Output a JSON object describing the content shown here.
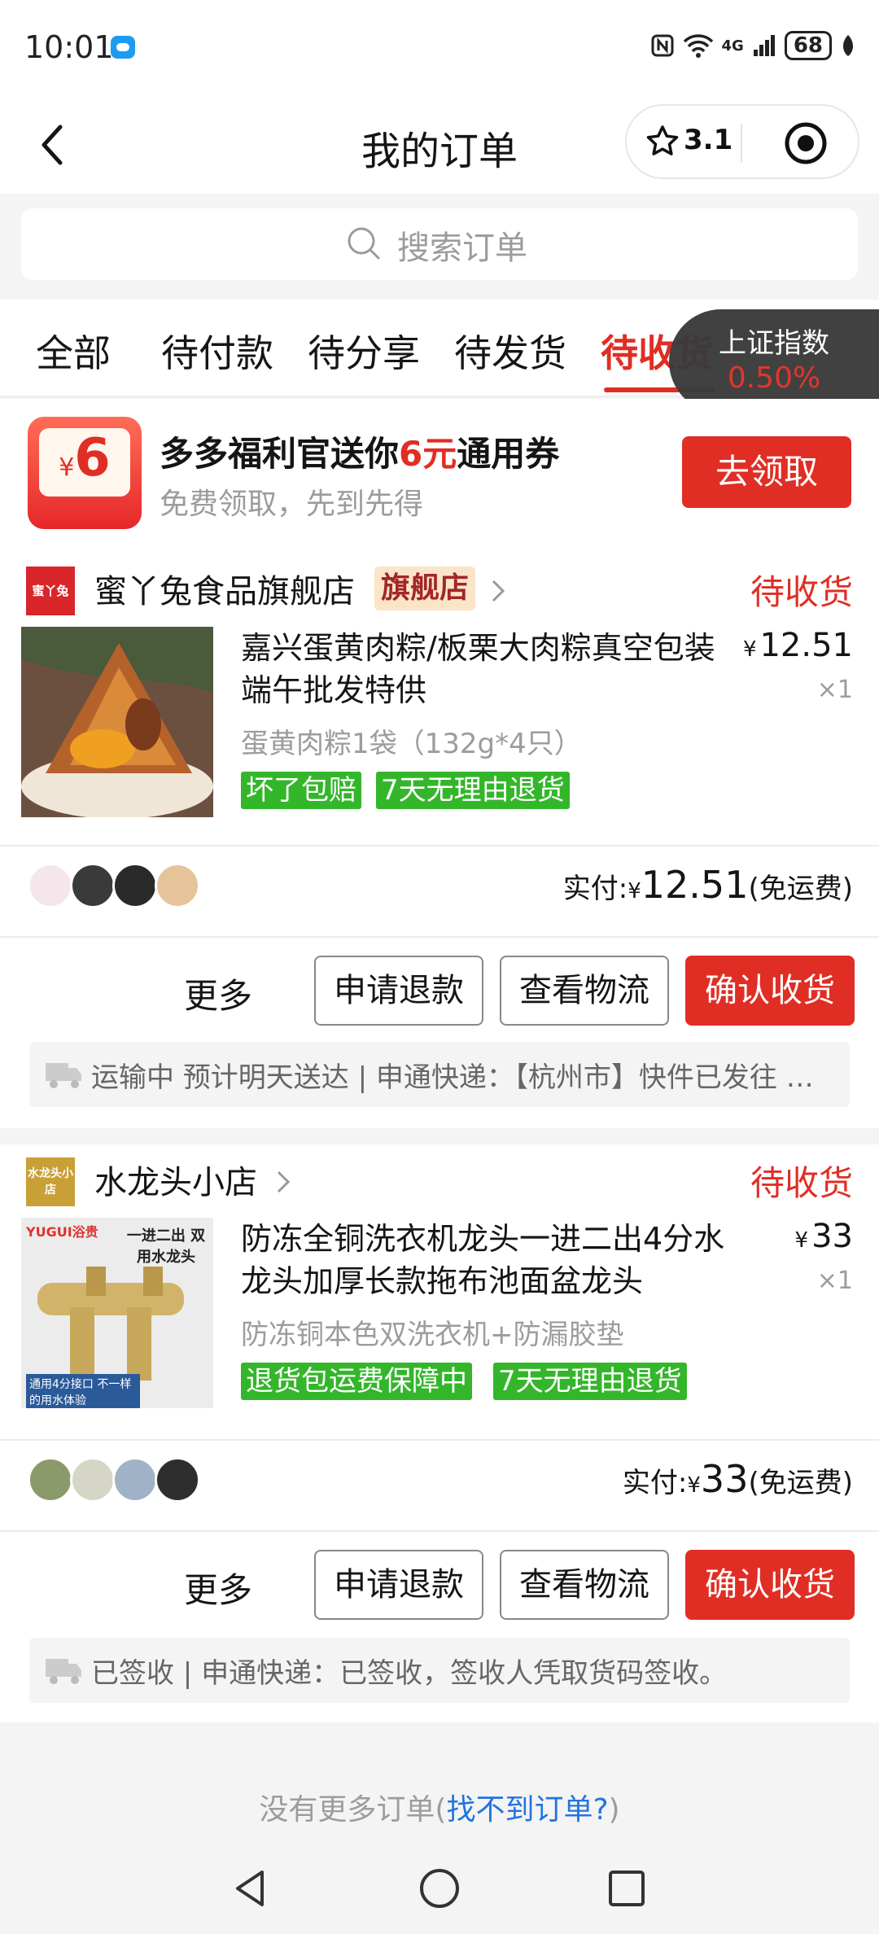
{
  "status_bar": {
    "time": "10:01",
    "network": "4G",
    "battery": "68"
  },
  "header": {
    "title": "我的订单",
    "back_icon": "chevron-left-icon",
    "rating": "3.1"
  },
  "search": {
    "placeholder": "搜索订单"
  },
  "tabs": [
    {
      "label": "全部"
    },
    {
      "label": "待付款"
    },
    {
      "label": "待分享"
    },
    {
      "label": "待发货"
    },
    {
      "label": "待收货",
      "active": true
    }
  ],
  "stock_widget": {
    "name": "上证指数",
    "value": "0.50%"
  },
  "coupon_banner": {
    "icon_currency": "¥",
    "icon_amount": "6",
    "title_prefix": "多多福利官送你",
    "title_highlight": "6元",
    "title_suffix": "通用券",
    "subtitle": "免费领取，先到先得",
    "button": "去领取"
  },
  "orders": [
    {
      "shop_logo_text": "蜜丫兔",
      "shop_name": "蜜丫兔食品旗舰店",
      "shop_badge": "旗舰店",
      "status": "待收货",
      "title": "嘉兴蛋黄肉粽/板栗大肉粽真空包装端午批发特供",
      "spec": "蛋黄肉粽1袋（132g*4只）",
      "currency": "¥",
      "price": "12.51",
      "qty": "×1",
      "tags": [
        "坏了包赔",
        "7天无理由退货"
      ],
      "paid_label": "实付:",
      "paid_amount": "12.51",
      "shipping_note": "(免运费)",
      "more": "更多",
      "buttons": [
        "申请退款",
        "查看物流",
        "确认收货"
      ],
      "logistics": "运输中 预计明天送达 | 申通快递：【杭州市】快件已发往 金华中转部"
    },
    {
      "shop_logo_text": "水龙头小店",
      "shop_name": "水龙头小店",
      "status": "待收货",
      "title": "防冻全铜洗衣机龙头一进二出4分水龙头加厚长款拖布池面盆龙头",
      "spec": "防冻铜本色双洗衣机+防漏胶垫",
      "currency": "¥",
      "price": "33",
      "qty": "×1",
      "tags": [
        "退货包运费保障中",
        "7天无理由退货"
      ],
      "thumb_brand": "YUGUI浴贵",
      "thumb_caption": "一进二出 双用水龙头",
      "thumb_note": "通用4分接口 不一样的用水体验",
      "paid_label": "实付:",
      "paid_amount": "33",
      "shipping_note": "(免运费)",
      "more": "更多",
      "buttons": [
        "申请退款",
        "查看物流",
        "确认收货"
      ],
      "logistics": "已签收 | 申通快递：已签收，签收人凭取货码签收。"
    }
  ],
  "footer": {
    "text": "没有更多订单(",
    "link": "找不到订单?",
    "close": ")"
  },
  "colors": {
    "accent": "#e02e24",
    "tag_green": "#34b62b",
    "link": "#2374e0"
  }
}
